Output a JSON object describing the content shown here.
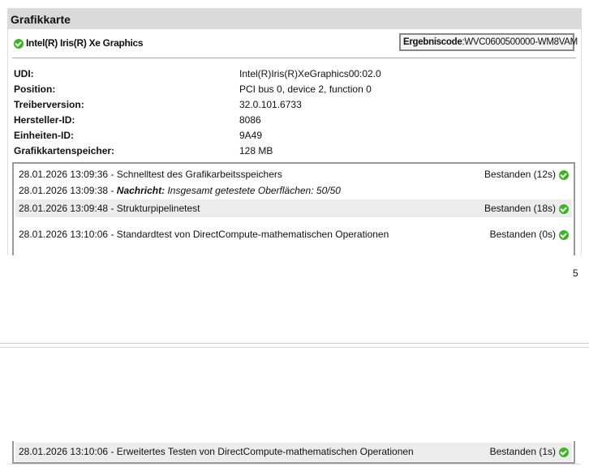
{
  "section": {
    "title": "Grafikkarte"
  },
  "device": {
    "name": "Intel(R) Iris(R) Xe Graphics",
    "result_label": "Ergebniscode",
    "result_code": "WVC0600500000-WM8VAM"
  },
  "info": [
    {
      "label": "UDI:",
      "value": "Intel(R)Iris(R)XeGraphics00:02.0"
    },
    {
      "label": "Position:",
      "value": "PCI bus 0, device 2, function 0"
    },
    {
      "label": "Treiberversion:",
      "value": "32.0.101.6733"
    },
    {
      "label": "Hersteller-ID:",
      "value": "8086"
    },
    {
      "label": "Einheiten-ID:",
      "value": "9A49"
    },
    {
      "label": "Grafikkartenspeicher:",
      "value": "128 MB"
    }
  ],
  "tests": [
    {
      "text": "28.01.2026 13:09:36 - Schnelltest des Grafikarbeitsspeichers",
      "result": "Bestanden (12s)"
    },
    {
      "prefix": "28.01.2026 13:09:38 - ",
      "msg_label": "Nachricht:",
      "msg": " Insgesamt getestete Oberflächen: 50/50"
    },
    {
      "text": "28.01.2026 13:09:48 - Strukturpipelinetest",
      "result": "Bestanden (18s)"
    },
    {
      "text": "28.01.2026 13:10:06 - Standardtest von DirectCompute-mathematischen Operationen",
      "result": "Bestanden (0s)"
    },
    {
      "text": "28.01.2026 13:10:06 - Erweitertes Testen von DirectCompute-mathematischen Operationen",
      "result": "Bestanden (1s)"
    }
  ],
  "page_number": "5",
  "colors": {
    "pass": "#3cb521",
    "header_bg": "#dadada"
  }
}
